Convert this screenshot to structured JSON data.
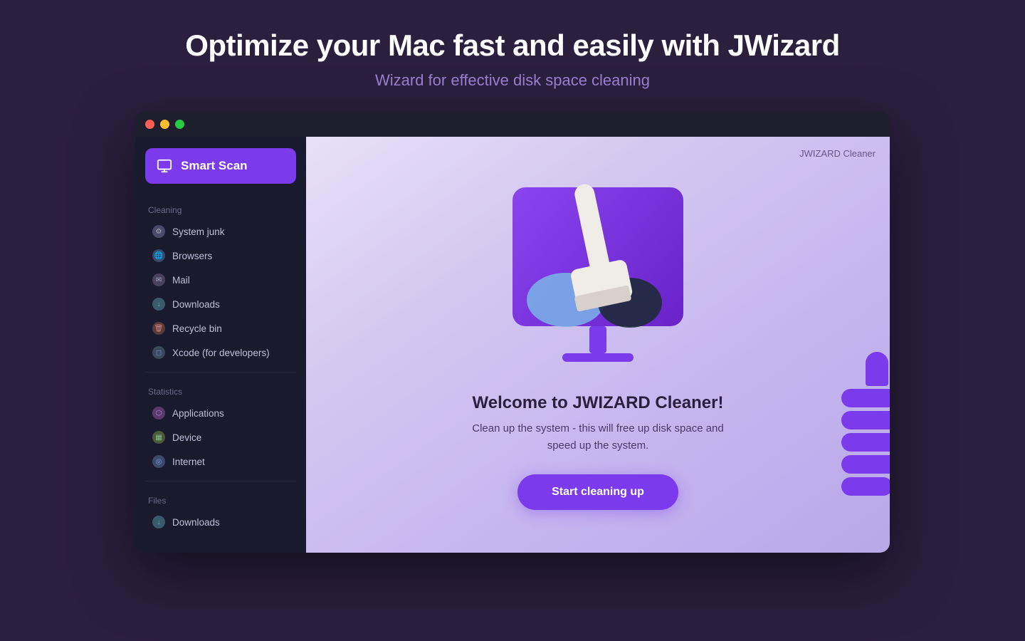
{
  "header": {
    "title": "Optimize your Mac fast and easily with JWizard",
    "subtitle": "Wizard for effective disk space cleaning"
  },
  "window": {
    "brand": "JWIZARD Cleaner"
  },
  "sidebar": {
    "smart_scan_label": "Smart Scan",
    "sections": [
      {
        "label": "Cleaning",
        "items": [
          {
            "id": "system-junk",
            "label": "System junk",
            "icon": "gear"
          },
          {
            "id": "browsers",
            "label": "Browsers",
            "icon": "globe"
          },
          {
            "id": "mail",
            "label": "Mail",
            "icon": "mail"
          },
          {
            "id": "downloads",
            "label": "Downloads",
            "icon": "download"
          },
          {
            "id": "recycle-bin",
            "label": "Recycle bin",
            "icon": "trash"
          },
          {
            "id": "xcode",
            "label": "Xcode (for developers)",
            "icon": "xcode"
          }
        ]
      },
      {
        "label": "Statistics",
        "items": [
          {
            "id": "applications",
            "label": "Applications",
            "icon": "apps"
          },
          {
            "id": "device",
            "label": "Device",
            "icon": "device"
          },
          {
            "id": "internet",
            "label": "Internet",
            "icon": "internet"
          }
        ]
      },
      {
        "label": "Files",
        "items": [
          {
            "id": "files-downloads",
            "label": "Downloads",
            "icon": "download"
          }
        ]
      }
    ]
  },
  "main": {
    "welcome_title": "Welcome to JWIZARD Cleaner!",
    "welcome_desc": "Clean up the system - this will free up disk space and speed up the system.",
    "cta_button": "Start cleaning up"
  }
}
